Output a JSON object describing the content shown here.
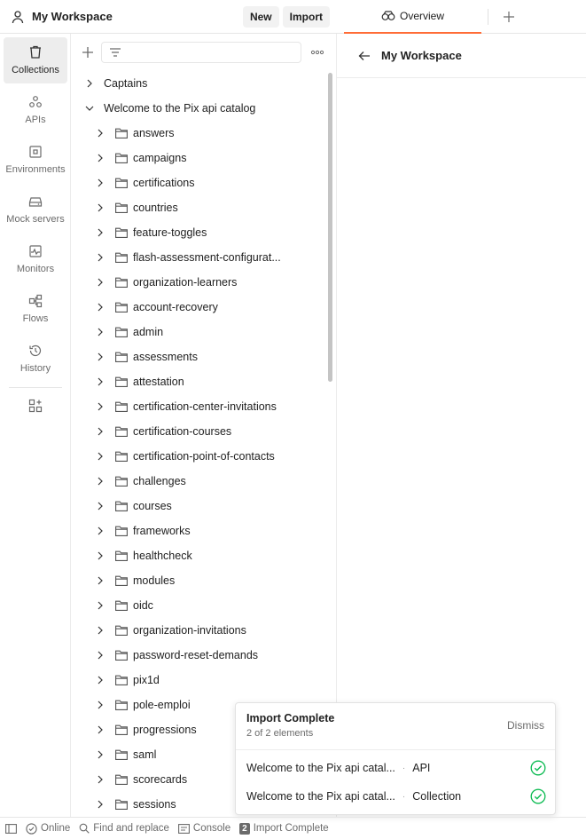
{
  "header": {
    "title": "My Workspace",
    "new_label": "New",
    "import_label": "Import"
  },
  "sidebar": {
    "items": [
      {
        "label": "Collections",
        "icon": "collections-icon",
        "active": true
      },
      {
        "label": "APIs",
        "icon": "apis-icon"
      },
      {
        "label": "Environments",
        "icon": "environments-icon"
      },
      {
        "label": "Mock servers",
        "icon": "mock-servers-icon"
      },
      {
        "label": "Monitors",
        "icon": "monitors-icon"
      },
      {
        "label": "Flows",
        "icon": "flows-icon"
      },
      {
        "label": "History",
        "icon": "history-icon"
      }
    ],
    "configure_icon": "add-apps-icon"
  },
  "tree": {
    "filter_placeholder": "",
    "collections": [
      {
        "name": "Captains",
        "expanded": false
      },
      {
        "name": "Welcome to the Pix api catalog",
        "expanded": true
      }
    ],
    "folders": [
      "answers",
      "campaigns",
      "certifications",
      "countries",
      "feature-toggles",
      "flash-assessment-configurat...",
      "organization-learners",
      "account-recovery",
      "admin",
      "assessments",
      "attestation",
      "certification-center-invitations",
      "certification-courses",
      "certification-point-of-contacts",
      "challenges",
      "courses",
      "frameworks",
      "healthcheck",
      "modules",
      "oidc",
      "organization-invitations",
      "password-reset-demands",
      "pix1d",
      "pole-emploi",
      "progressions",
      "saml",
      "scorecards",
      "sessions"
    ]
  },
  "tabs": {
    "active_label": "Overview"
  },
  "content": {
    "title": "My Workspace"
  },
  "toast": {
    "title": "Import Complete",
    "subtitle": "2 of 2 elements",
    "dismiss_label": "Dismiss",
    "items": [
      {
        "name": "Welcome to the Pix api catal...",
        "type": "API"
      },
      {
        "name": "Welcome to the Pix api catal...",
        "type": "Collection"
      }
    ]
  },
  "statusbar": {
    "online_label": "Online",
    "find_label": "Find and replace",
    "console_label": "Console",
    "import_badge": "2",
    "import_label": "Import Complete"
  },
  "colors": {
    "accent": "#ff6c37",
    "success": "#0cbb52"
  }
}
